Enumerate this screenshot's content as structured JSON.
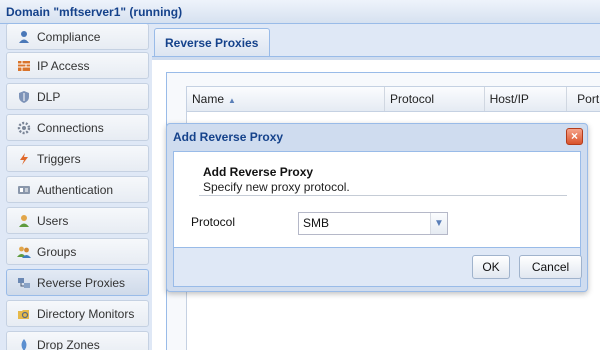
{
  "window": {
    "title": "Domain \"mftserver1\" (running)"
  },
  "sidebar": {
    "items": [
      {
        "label": "Compliance",
        "icon": "person-badge-icon"
      },
      {
        "label": "IP Access",
        "icon": "firewall-icon"
      },
      {
        "label": "DLP",
        "icon": "shield-icon"
      },
      {
        "label": "Connections",
        "icon": "gear-icon"
      },
      {
        "label": "Triggers",
        "icon": "lightning-icon"
      },
      {
        "label": "Authentication",
        "icon": "id-card-icon"
      },
      {
        "label": "Users",
        "icon": "user-icon"
      },
      {
        "label": "Groups",
        "icon": "users-icon"
      },
      {
        "label": "Reverse Proxies",
        "icon": "proxy-icon"
      },
      {
        "label": "Directory Monitors",
        "icon": "folder-monitor-icon"
      },
      {
        "label": "Drop Zones",
        "icon": "drop-zone-icon"
      }
    ],
    "active": "Reverse Proxies"
  },
  "main": {
    "tab": "Reverse Proxies",
    "grid": {
      "columns": [
        "Name",
        "Protocol",
        "Host/IP",
        "Port"
      ],
      "sort": "Name"
    }
  },
  "dialog": {
    "title": "Add Reverse Proxy",
    "heading": "Add Reverse Proxy",
    "subheading": "Specify new proxy protocol.",
    "protocol_label": "Protocol",
    "protocol_value": "SMB",
    "ok_label": "OK",
    "cancel_label": "Cancel"
  },
  "colors": {
    "header_text": "#15428b",
    "frame_border": "#99bbe8",
    "background": "#dfe8f6",
    "close_button": "#d9532b"
  }
}
